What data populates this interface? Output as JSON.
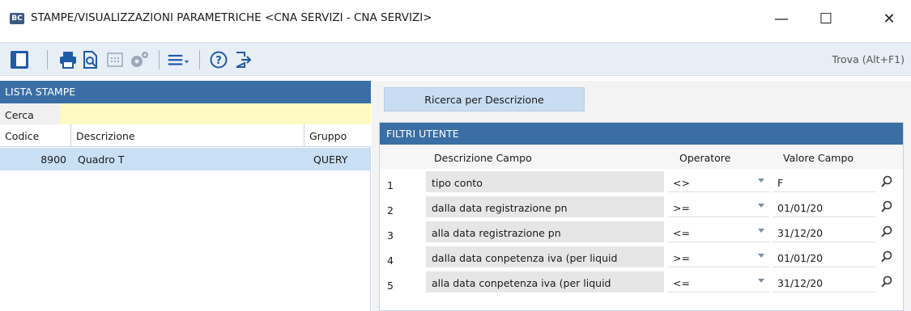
{
  "window": {
    "logo": "BC",
    "title": "STAMPE/VISUALIZZAZIONI PARAMETRICHE <CNA SERVIZI - CNA SERVIZI>",
    "minimize": "—",
    "maximize": "☐",
    "close": "✕"
  },
  "toolbar": {
    "icons": [
      "panel-icon",
      "print-icon",
      "print-preview-icon",
      "calculator-icon",
      "settings-icon",
      "menu-icon",
      "help-icon",
      "exit-icon"
    ],
    "search_label": "Trova (Alt+F1)"
  },
  "lista": {
    "header": "LISTA STAMPE",
    "cerca_label": "Cerca",
    "cerca_value": "",
    "columns": [
      "Codice",
      "Descrizione",
      "Gruppo"
    ],
    "rows": [
      {
        "codice": "8900",
        "descrizione": "Quadro T",
        "gruppo": "QUERY"
      }
    ]
  },
  "ricerca_button": "Ricerca per Descrizione",
  "filtri": {
    "header": "FILTRI UTENTE",
    "columns": [
      "Descrizione Campo",
      "Operatore",
      "Valore Campo"
    ],
    "rows": [
      {
        "num": "1",
        "campo": "tipo conto",
        "operatore": "<>",
        "valore": "F"
      },
      {
        "num": "2",
        "campo": "dalla data registrazione pn",
        "operatore": ">=",
        "valore": "01/01/20"
      },
      {
        "num": "3",
        "campo": "alla data registrazione pn",
        "operatore": "<=",
        "valore": "31/12/20"
      },
      {
        "num": "4",
        "campo": "dalla data conpetenza iva (per liquid",
        "operatore": ">=",
        "valore": "01/01/20"
      },
      {
        "num": "5",
        "campo": "alla data conpetenza iva (per liquid",
        "operatore": "<=",
        "valore": "31/12/20"
      }
    ]
  },
  "colors": {
    "header_blue": "#3a6ea5",
    "toolbar_bg": "#e8eef6",
    "selected_row": "#c9dff3",
    "search_field": "#fff9c4",
    "icon_blue": "#1f5aa8"
  }
}
